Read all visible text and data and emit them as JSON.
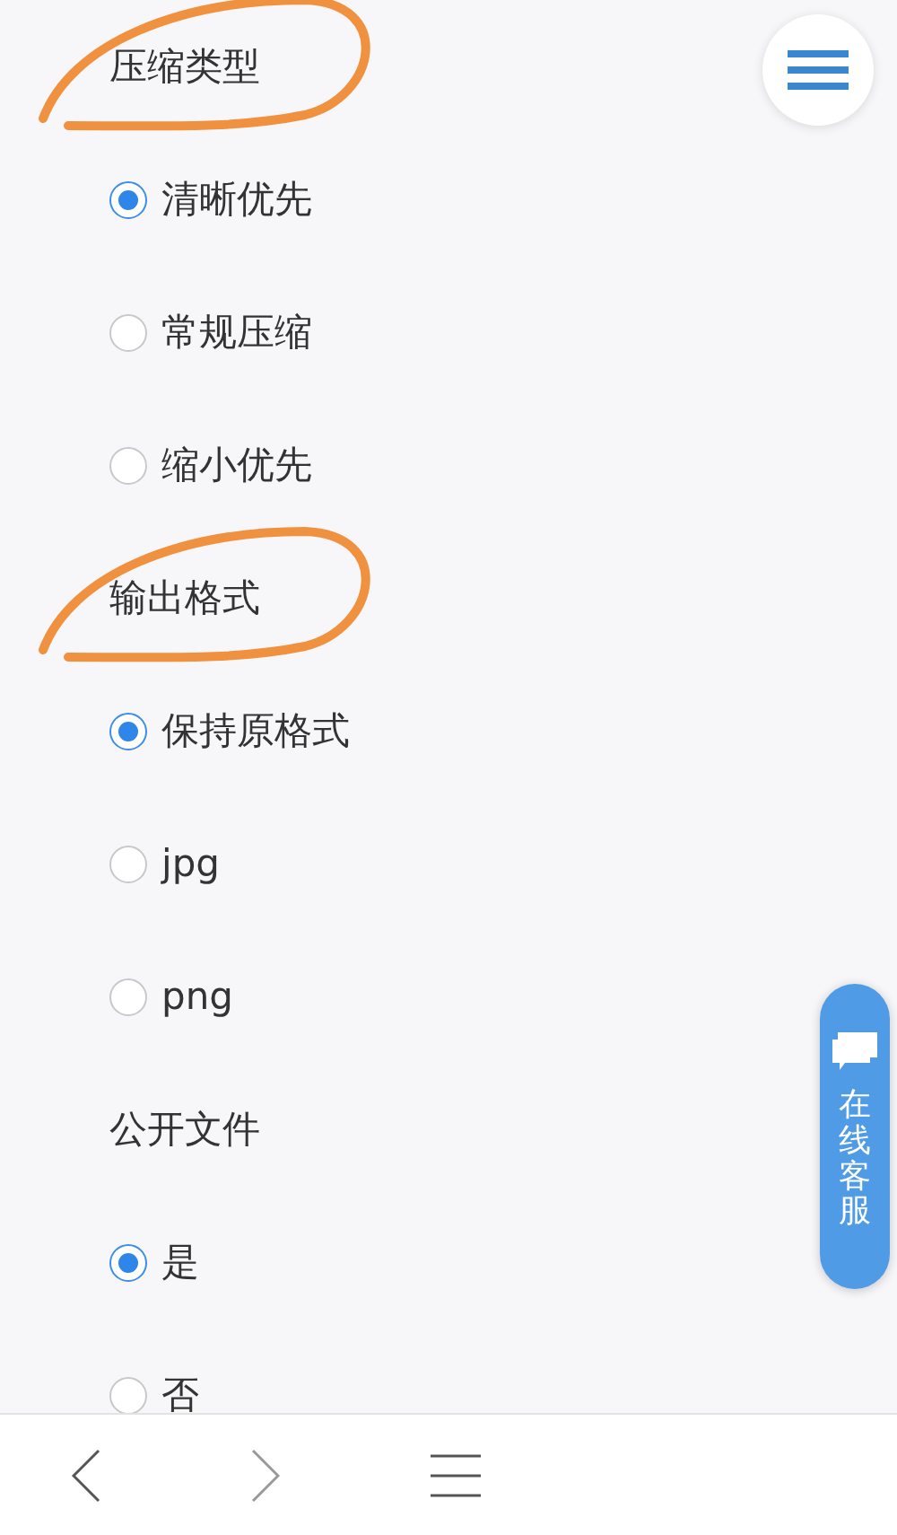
{
  "groups": [
    {
      "title": "压缩类型",
      "annotated": true,
      "options": [
        {
          "label": "清晰优先",
          "selected": true
        },
        {
          "label": "常规压缩",
          "selected": false
        },
        {
          "label": "缩小优先",
          "selected": false
        }
      ]
    },
    {
      "title": "输出格式",
      "annotated": true,
      "options": [
        {
          "label": "保持原格式",
          "selected": true
        },
        {
          "label": "jpg",
          "selected": false
        },
        {
          "label": "png",
          "selected": false
        }
      ]
    },
    {
      "title": "公开文件",
      "annotated": false,
      "options": [
        {
          "label": "是",
          "selected": true
        },
        {
          "label": "否",
          "selected": false
        }
      ]
    }
  ],
  "chat_button": {
    "label": "在线客服"
  }
}
